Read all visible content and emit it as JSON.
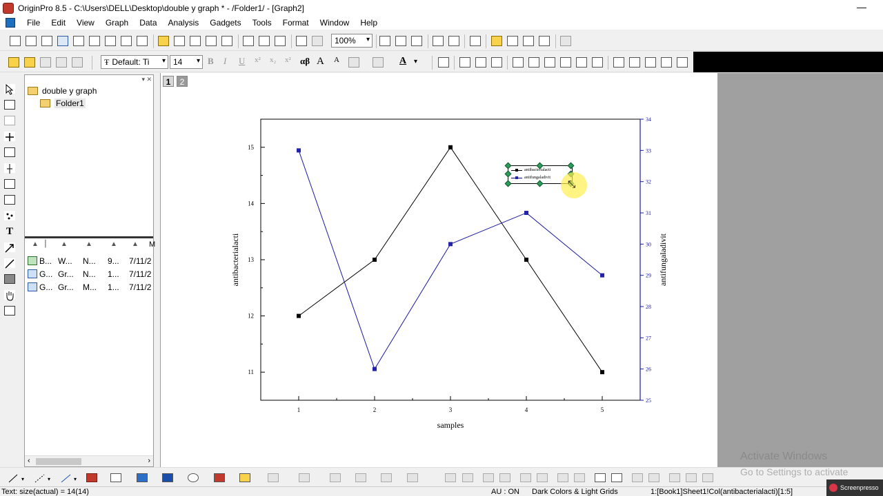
{
  "window": {
    "title": "OriginPro 8.5 - C:\\Users\\DELL\\Desktop\\double y graph * - /Folder1/ - [Graph2]",
    "minimize_glyph": "—"
  },
  "menu": [
    "File",
    "Edit",
    "View",
    "Graph",
    "Data",
    "Analysis",
    "Gadgets",
    "Tools",
    "Format",
    "Window",
    "Help"
  ],
  "toolbar": {
    "zoom_value": "100%",
    "font_value": "Default: Ti",
    "font_size_value": "14",
    "bold": "B",
    "italic": "I",
    "underline": "U",
    "superscript": "x²",
    "subscript": "x₂",
    "greek": "αβ",
    "font_grow": "A",
    "font_shrink": "A"
  },
  "explorer": {
    "project": "double y graph",
    "folder": "Folder1",
    "rows": [
      {
        "icon": "book-icon",
        "name": "B...",
        "type": "W...",
        "view": "N...",
        "size": "9...",
        "modified": "7/11/2"
      },
      {
        "icon": "graph-icon",
        "name": "G...",
        "type": "Gr...",
        "view": "N...",
        "size": "1...",
        "modified": "7/11/2"
      },
      {
        "icon": "graph-icon",
        "name": "G...",
        "type": "Gr...",
        "view": "M...",
        "size": "1...",
        "modified": "7/11/2"
      }
    ],
    "header_last": "M"
  },
  "layers": [
    "1",
    "2"
  ],
  "chart_data": {
    "type": "line",
    "xlabel": "samples",
    "ylabel_left": "antibacterialacti",
    "ylabel_right": "antifungaladivit",
    "x": [
      1,
      2,
      3,
      4,
      5
    ],
    "xlim": [
      0.5,
      5.5
    ],
    "ylim_left": [
      10.5,
      15.5
    ],
    "ylim_right": [
      25,
      34
    ],
    "xticks": [
      "1",
      "2",
      "3",
      "4",
      "5"
    ],
    "yticks_left": [
      "11",
      "12",
      "13",
      "14",
      "15"
    ],
    "yticks_right": [
      "25",
      "26",
      "27",
      "28",
      "29",
      "30",
      "31",
      "32",
      "33",
      "34"
    ],
    "series": [
      {
        "name": "antibacterialacti",
        "axis": "left",
        "color": "#000000",
        "values": [
          12,
          13,
          15,
          13,
          11
        ]
      },
      {
        "name": "antifungaladivit",
        "axis": "right",
        "color": "#1a1aa0",
        "values": [
          33,
          26,
          30,
          31,
          29
        ]
      }
    ],
    "legend": "top-right",
    "grid": false
  },
  "status": {
    "left": "Text: size(actual) = 14(14)",
    "au": "AU : ON",
    "theme": "Dark Colors & Light Grids",
    "ref": "1:[Book1]Sheet1!Col(antibacterialacti)[1:5]"
  },
  "watermark": {
    "line1": "Activate Windows",
    "line2": "Go to Settings to activate"
  },
  "screenpresso": "Screenpresso"
}
